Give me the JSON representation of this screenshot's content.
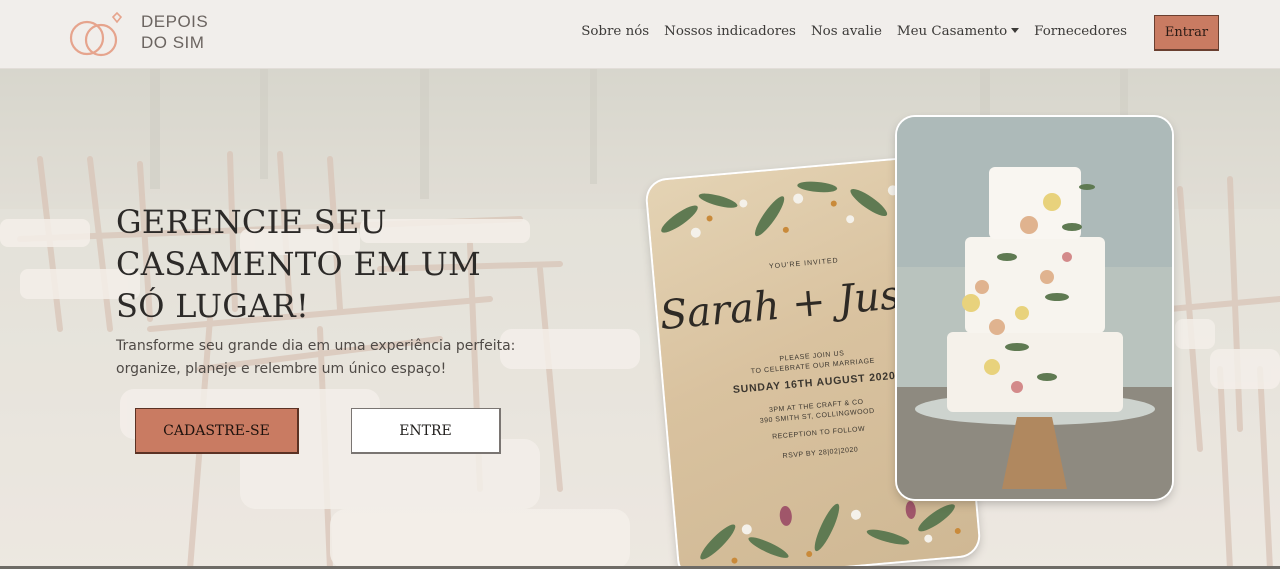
{
  "brand": {
    "name_line1": "DEPOIS",
    "name_line2": "DO SIM",
    "colors": {
      "accent": "#c97b62",
      "logo": "#e6a48d"
    }
  },
  "nav": {
    "links": [
      "Sobre nós",
      "Nossos indicadores",
      "Nos avalie",
      "Meu Casamento",
      "Fornecedores"
    ],
    "login_label": "Entrar"
  },
  "hero": {
    "title": "GERENCIE SEU CASAMENTO EM UM SÓ LUGAR!",
    "subtitle": "Transforme seu grande dia em uma experiência perfeita: organize, planeje e relembre um único espaço!",
    "signup_label": "CADASTRE-SE",
    "enter_label": "ENTRE"
  },
  "invitation": {
    "invited": "YOU'RE INVITED",
    "names": "Sarah + Justin",
    "join_line1": "PLEASE JOIN US",
    "join_line2": "TO CELEBRATE OUR MARRIAGE",
    "date": "SUNDAY 16TH AUGUST 2020",
    "place_line1": "3PM AT THE CRAFT & CO",
    "place_line2": "390 SMITH ST, COLLINGWOOD",
    "reception": "RECEPTION TO FOLLOW",
    "rsvp": "RSVP BY 28|02|2020"
  }
}
